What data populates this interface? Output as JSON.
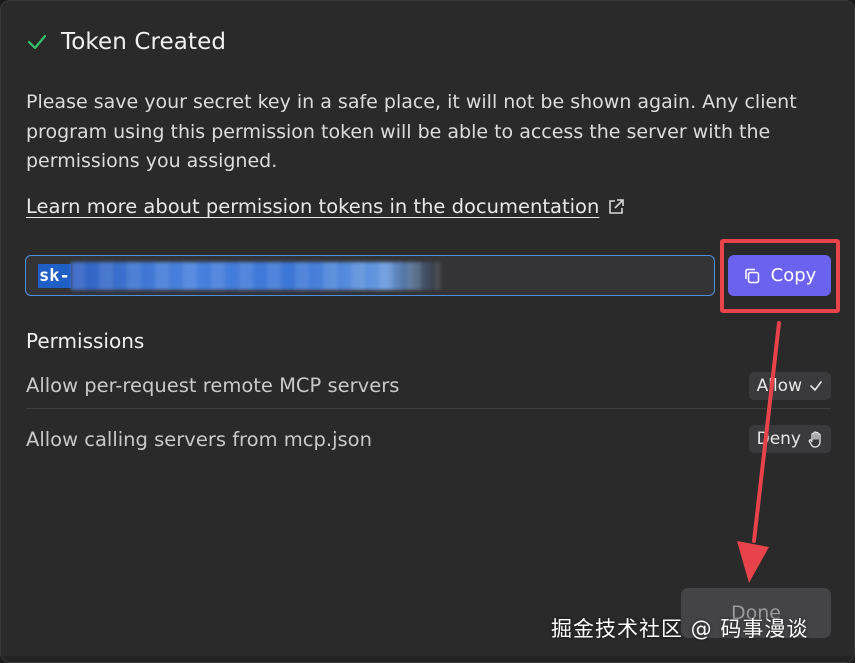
{
  "dialog": {
    "title": "Token Created",
    "description": "Please save your secret key in a safe place, it will not be shown again. Any client program using this permission token will be able to access the server with the permissions you assigned.",
    "doc_link": "Learn more about permission tokens in the documentation",
    "token": {
      "visible_prefix": "sk-"
    },
    "copy_label": "Copy",
    "permissions": {
      "title": "Permissions",
      "items": [
        {
          "label": "Allow per-request remote MCP servers",
          "value": "Allow"
        },
        {
          "label": "Allow calling servers from mcp.json",
          "value": "Deny"
        }
      ]
    },
    "done_label": "Done"
  },
  "watermark": "掘金技术社区 @ 码事漫谈",
  "colors": {
    "accent": "#6b63f0",
    "success": "#33c46a",
    "highlight": "#e8434a",
    "focus_border": "#4d8fe0"
  },
  "icons": {
    "title": "check-icon",
    "doc_link": "external-link-icon",
    "copy": "copy-icon",
    "allow": "checkmark-icon",
    "deny": "hand-icon"
  }
}
